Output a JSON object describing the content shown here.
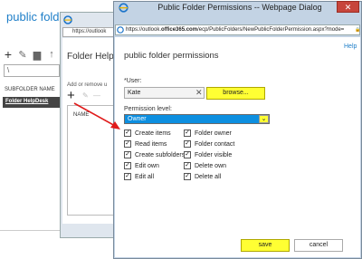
{
  "background": {
    "title": "public folders",
    "toolbar_icons": [
      "add-icon",
      "edit-icon",
      "delete-icon",
      "move-up-icon",
      "refresh-icon"
    ],
    "search_placeholder": "\\",
    "column_header": "SUBFOLDER NAME",
    "selected_row": "Folder HelpDesk"
  },
  "background_window": {
    "address": "https://outlook",
    "heading": "Folder Help",
    "text": "Add or remove u",
    "column": "NAME"
  },
  "dialog": {
    "title": "Public Folder Permissions -- Webpage Dialog",
    "address_prefix": "https://outlook.",
    "address_host": "office365.com",
    "address_suffix": "/ecp/PublicFolders/NewPublicFolderPermission.aspx?mode=",
    "help": "Help",
    "heading": "public folder permissions",
    "user_label": "*User:",
    "user_value": "Kate",
    "browse_label": "browse...",
    "permission_label": "Permission level:",
    "permission_value": "Owner",
    "checkboxes_left": [
      {
        "label": "Create items",
        "checked": true
      },
      {
        "label": "Read items",
        "checked": true
      },
      {
        "label": "Create subfolders",
        "checked": true
      },
      {
        "label": "Edit own",
        "checked": true
      },
      {
        "label": "Edit all",
        "checked": true
      }
    ],
    "checkboxes_right": [
      {
        "label": "Folder owner",
        "checked": true
      },
      {
        "label": "Folder contact",
        "checked": true
      },
      {
        "label": "Folder visible",
        "checked": true
      },
      {
        "label": "Delete own",
        "checked": true
      },
      {
        "label": "Delete all",
        "checked": true
      }
    ],
    "save_label": "save",
    "cancel_label": "cancel"
  },
  "colors": {
    "accent": "#1e7ec8",
    "highlight_yellow": "#ffff33",
    "select_blue": "#0d8fe0",
    "arrow_red": "#e01b1b"
  }
}
